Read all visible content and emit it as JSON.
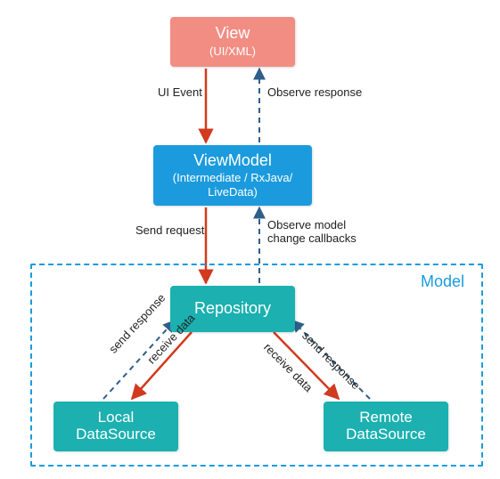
{
  "boxes": {
    "view": {
      "title": "View",
      "subtitle": "(UI/XML)"
    },
    "viewmodel": {
      "title": "ViewModel",
      "subtitle": "(Intermediate / RxJava/\nLiveData)"
    },
    "repository": {
      "title": "Repository"
    },
    "local": {
      "title": "Local\nDataSource"
    },
    "remote": {
      "title": "Remote\nDataSource"
    }
  },
  "frame": {
    "label": "Model"
  },
  "edges": {
    "ui_event": "UI Event",
    "observe_response": "Observe response",
    "send_request": "Send request",
    "observe_model": "Observe model\nchange callbacks",
    "local_receive": "receive data",
    "local_send": "send response",
    "remote_receive": "receive data",
    "remote_send": "send response"
  },
  "colors": {
    "view": "#f28d84",
    "viewmodel": "#1b9bdd",
    "teal": "#1cb0b0",
    "solid_arrow": "#d13a1f",
    "dashed_arrow": "#2e5f8a"
  }
}
